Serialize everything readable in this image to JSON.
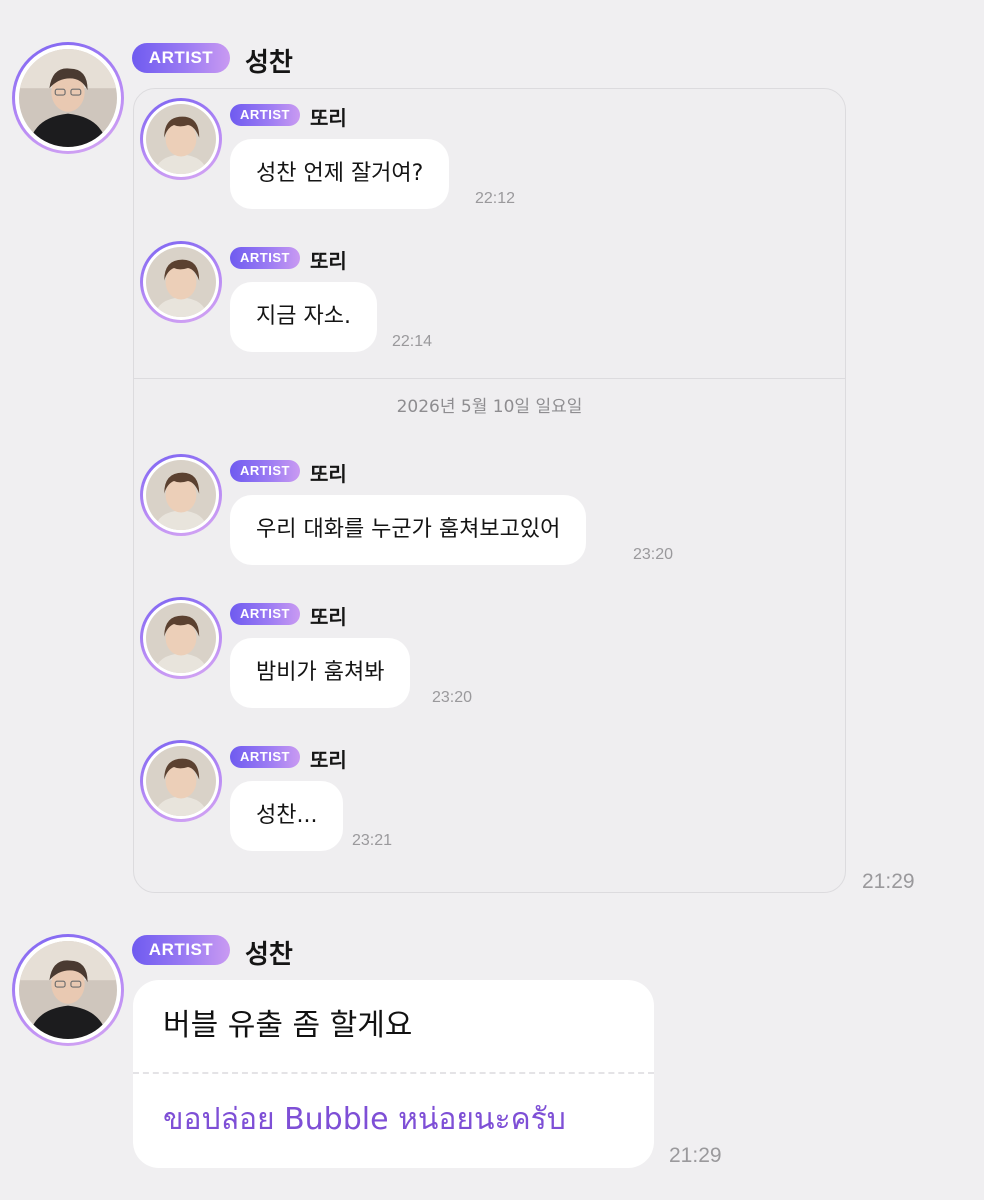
{
  "theme": {
    "accent": "#7e4fd6",
    "badge_gradient": [
      "#6f5bf0",
      "#c99af2"
    ],
    "background": "#f0eff1",
    "bubble": "#ffffff",
    "timestamp": "#9a999c"
  },
  "posts": [
    {
      "badge": "ARTIST",
      "sender": "성찬",
      "time": "21:29",
      "quoted_thread": {
        "messages": [
          {
            "badge": "ARTIST",
            "sender": "또리",
            "text": "성찬 언제 잘거여?",
            "time": "22:12"
          },
          {
            "badge": "ARTIST",
            "sender": "또리",
            "text": "지금 자소.",
            "time": "22:14"
          }
        ],
        "date_separator": "2026년 5월 10일 일요일",
        "messages_after": [
          {
            "badge": "ARTIST",
            "sender": "또리",
            "text": "우리 대화를 누군가 훔쳐보고있어",
            "time": "23:20"
          },
          {
            "badge": "ARTIST",
            "sender": "또리",
            "text": "밤비가 훔쳐봐",
            "time": "23:20"
          },
          {
            "badge": "ARTIST",
            "sender": "또리",
            "text": "성찬...",
            "time": "23:21"
          }
        ]
      }
    },
    {
      "badge": "ARTIST",
      "sender": "성찬",
      "time": "21:29",
      "text": "버블 유출 좀 할게요",
      "translation": "ขอปล่อย Bubble หน่อยนะครับ"
    }
  ]
}
